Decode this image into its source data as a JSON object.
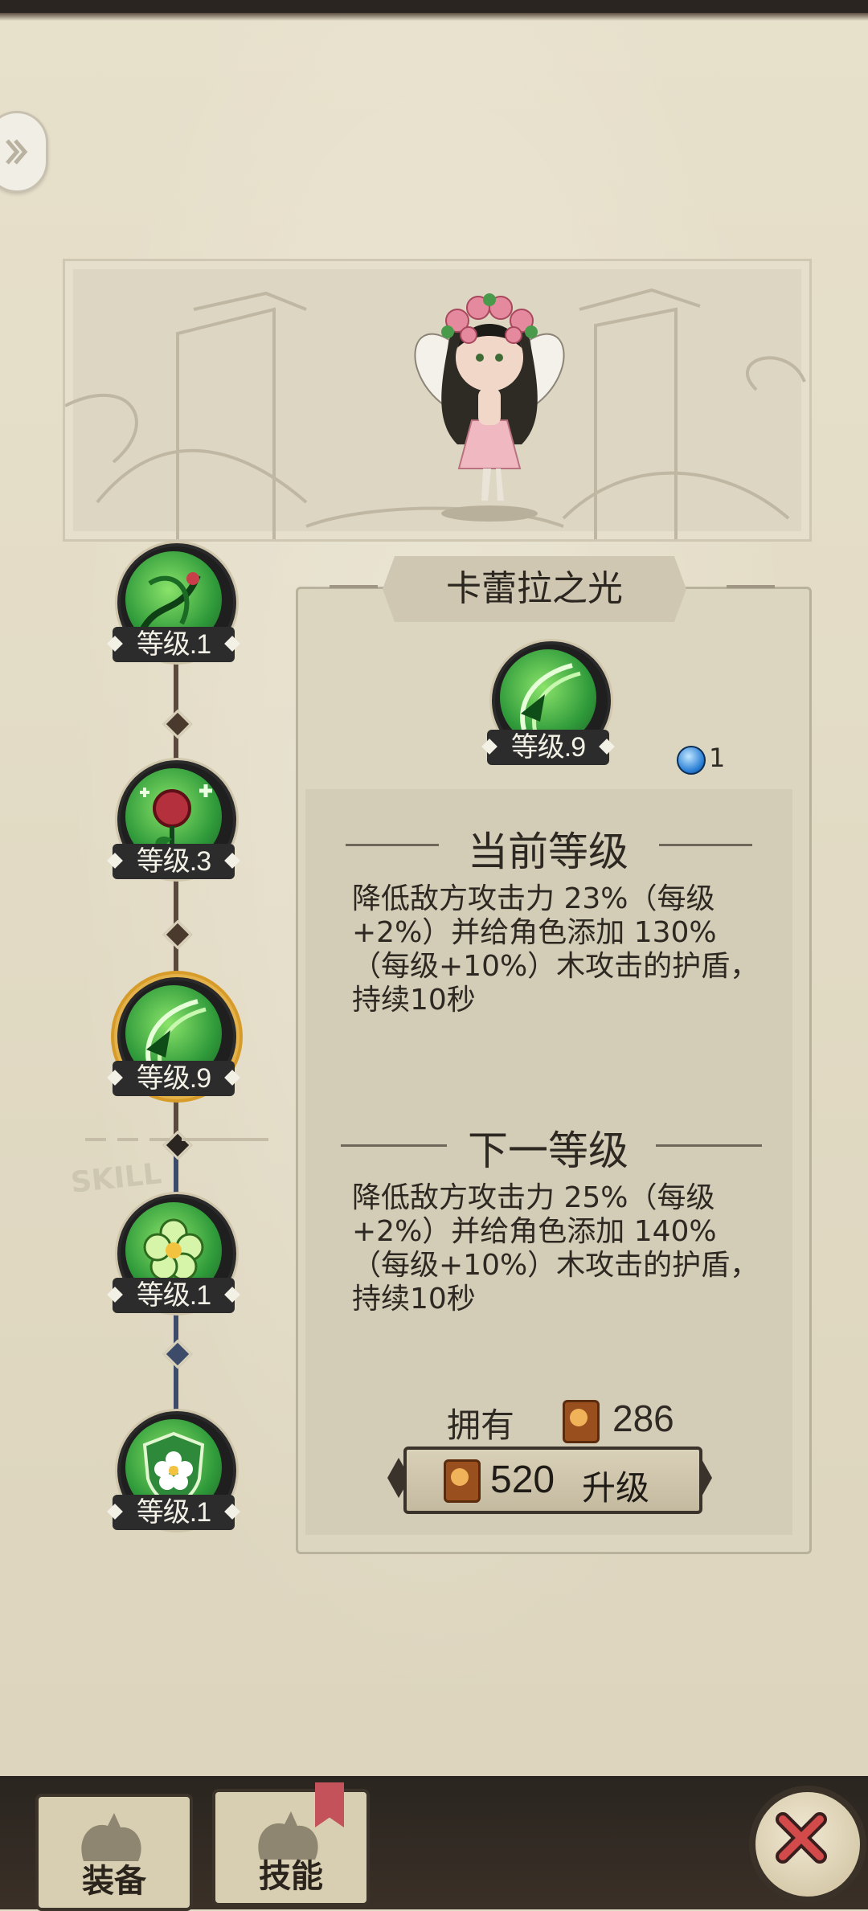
{
  "character": {
    "portrait_icon": "flower-fairy-character"
  },
  "skill_tree": [
    {
      "icon": "vine-thorn-icon",
      "level_text": "等级.1"
    },
    {
      "icon": "rose-heal-icon",
      "level_text": "等级.3"
    },
    {
      "icon": "leaf-slash-icon",
      "level_text": "等级.9",
      "selected": true
    },
    {
      "icon": "flower-blossom-icon",
      "level_text": "等级.1"
    },
    {
      "icon": "flower-shield-icon",
      "level_text": "等级.1"
    }
  ],
  "detail": {
    "skill_name": "卡蕾拉之光",
    "level_text": "等级.9",
    "mana_cost": "1",
    "current_header": "当前等级",
    "current_desc": "降低敌方攻击力 23%（每级+2%）并给角色添加 130%（每级+10%）木攻击的护盾，持续10秒",
    "next_header": "下一等级",
    "next_desc": "降低敌方攻击力 25%（每级+2%）并给角色添加 140%（每级+10%）木攻击的护盾，持续10秒",
    "own_label": "拥有",
    "own_count": "286",
    "upgrade_cost": "520",
    "upgrade_label": "升级"
  },
  "bottom_tabs": [
    {
      "label": "装备"
    },
    {
      "label": "技能",
      "active": true
    }
  ]
}
